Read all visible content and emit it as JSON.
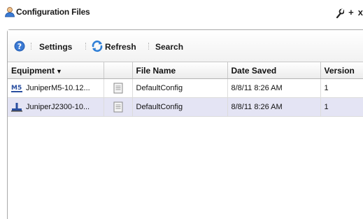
{
  "window": {
    "title": "Configuration Files",
    "actions": [
      {
        "icon": "wrench-icon",
        "glyph": "✎"
      },
      {
        "icon": "plus-icon",
        "glyph": "+"
      },
      {
        "icon": "close-icon",
        "glyph": "x"
      }
    ]
  },
  "toolbar": {
    "settings_label": "Settings",
    "refresh_label": "Refresh",
    "search_label": "Search"
  },
  "table": {
    "columns": [
      "Equipment",
      "",
      "File Name",
      "Date Saved",
      "Version"
    ],
    "sort_indicator": "▼",
    "rows": [
      {
        "equipment": "JuniperM5-10.12...",
        "equipment_icon_label": "M5",
        "file_name": "DefaultConfig",
        "date_saved": "8/8/11 8:26 AM",
        "version": "1"
      },
      {
        "equipment": "JuniperJ2300-10...",
        "equipment_icon_label": "",
        "file_name": "DefaultConfig",
        "date_saved": "8/8/11 8:26 AM",
        "version": "1"
      }
    ]
  },
  "colors": {
    "selected_row": "#e4e4f4",
    "help_icon": "#2a63b8",
    "refresh_icon": "#2f7fd6",
    "m5_icon": "#2a4fa0",
    "j2300_icon": "#2a4fa0"
  }
}
